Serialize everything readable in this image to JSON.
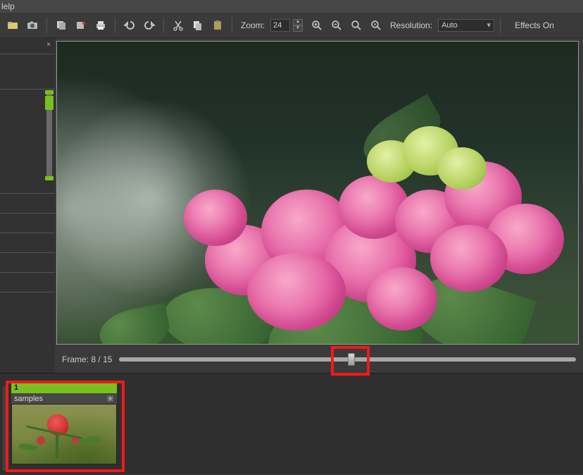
{
  "menu": {
    "help": "lelp"
  },
  "toolbar": {
    "zoom_label": "Zoom:",
    "zoom_value": "24",
    "resolution_label": "Resolution:",
    "resolution_value": "Auto",
    "effects_label": "Effects On"
  },
  "preview": {
    "frame_label": "Frame:",
    "current_frame": "8",
    "frame_sep": "/",
    "total_frames": "15"
  },
  "timeline": {
    "clip": {
      "index": "1",
      "name": "samples"
    }
  },
  "icons": {
    "open": "open-icon",
    "save": "save-icon",
    "stack": "stack-icon",
    "record": "record-icon",
    "print": "print-icon",
    "undo": "undo-icon",
    "redo": "redo-icon",
    "cut": "cut-icon",
    "copy": "copy-icon",
    "paste": "paste-icon",
    "zoom_in": "zoom-in-icon",
    "zoom_out": "zoom-out-icon",
    "zoom_fit": "zoom-fit-icon",
    "zoom_100": "zoom-100-icon"
  }
}
